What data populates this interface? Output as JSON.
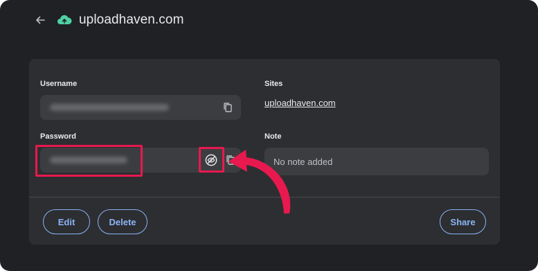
{
  "header": {
    "title": "uploadhaven.com",
    "back_icon": "arrow-left-icon",
    "site_icon": "cloud-icon"
  },
  "username": {
    "label": "Username",
    "value": "●●●●●●●●●●●●●●●●●●●●",
    "copy_icon": "copy-icon"
  },
  "password": {
    "label": "Password",
    "value": "●●●●●●●●●●●●●",
    "reveal_icon": "eye-off-icon",
    "copy_icon": "copy-icon"
  },
  "sites": {
    "label": "Sites",
    "link": "uploadhaven.com"
  },
  "note": {
    "label": "Note",
    "value": "No note added"
  },
  "actions": {
    "edit": "Edit",
    "delete": "Delete",
    "share": "Share"
  },
  "colors": {
    "background": "#202124",
    "card": "#2d2e31",
    "field": "#3c3d40",
    "accent": "#8ab4f8",
    "highlight": "#e8194f",
    "brand": "#4fd1a5"
  }
}
